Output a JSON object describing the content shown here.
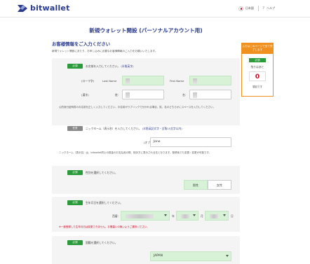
{
  "header": {
    "brand": "bitwallet",
    "language": "日本語",
    "help": "ヘルプ"
  },
  "page_title": "新規ウォレット開設 (パーソナルアカウント用)",
  "section": {
    "title": "お客様情報をご入力ください",
    "desc": "新規ウォレット開設にあたり、お申し込みに必要なお客様情報のご入力をお願いいたします。"
  },
  "name_block": {
    "badge": "必須",
    "label": "お名前を入力してください。",
    "hint": "(半角英字)",
    "roman_label": "(ローマ字)",
    "last_name_label": "Last Name",
    "first_name_label": "First Name",
    "kanji_label": "(漢字)",
    "sei_label": "姓：",
    "mei_label": "名：",
    "note": "公的身分証明書のお名前を正しく入力してください。お名前がラブリックで分かれる場合、姓、名のどちらかにスペースを入力してください。"
  },
  "nickname_block": {
    "badge": "任意",
    "label": "ニックネーム（表示名）を入力してください。",
    "hint": "(半角英記文字・全角15文字以内)",
    "option_label": "(オプション)",
    "value": "Jono",
    "note": "ニックネーム（表示名）は、bitwallet同士の振金のお支払用の際、相手方に表示される名となります。登録後でも変更・変更が可能です。"
  },
  "gender_block": {
    "badge": "必須",
    "label": "性別を選択してください。",
    "male": "男性",
    "female": "女性"
  },
  "dob_block": {
    "badge": "必須",
    "label": "生年月日を選択してください。",
    "era_label": "西暦：",
    "year_unit": "年",
    "month_unit": "月",
    "day_unit": "日",
    "warning": "※一度登録した生年月日は変更できません。お間違いの無いようご選択ください。"
  },
  "country_block": {
    "badge": "必須",
    "label": "国籍を選択してください。",
    "value": "JAPAN"
  },
  "side_panel": {
    "top_text": "入力はこのページで全て完了します",
    "badge": "必須",
    "sub": "残りはあと",
    "count": "0",
    "confirm": "項目です"
  },
  "colors": {
    "brand": "#2a3a8c",
    "required": "#2a9a3b",
    "accent": "#f0901e",
    "field_fill": "#d7f2d6",
    "warning": "#d0021b"
  }
}
